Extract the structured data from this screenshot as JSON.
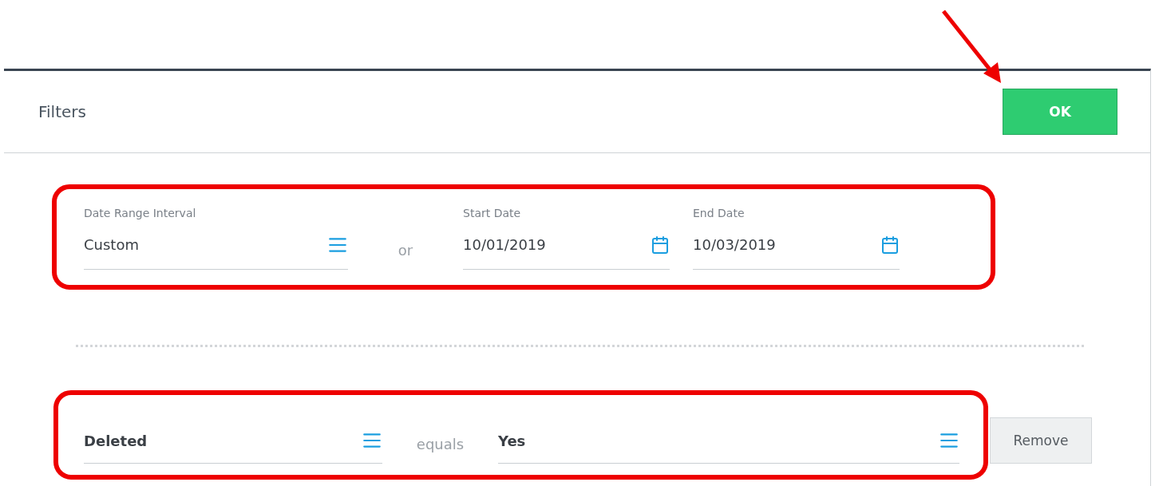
{
  "header": {
    "title": "Filters",
    "ok_button": "OK"
  },
  "date_filter": {
    "fields": [
      {
        "kind": "select",
        "label": "Date Range Interval",
        "value": "Custom"
      },
      {
        "kind": "connector",
        "text": "or"
      },
      {
        "kind": "date",
        "label": "Start Date",
        "value": "10/01/2019"
      },
      {
        "kind": "date",
        "label": "End Date",
        "value": "10/03/2019"
      }
    ]
  },
  "condition": {
    "field": "Deleted",
    "operator": "equals",
    "value": "Yes",
    "remove_button": "Remove"
  }
}
